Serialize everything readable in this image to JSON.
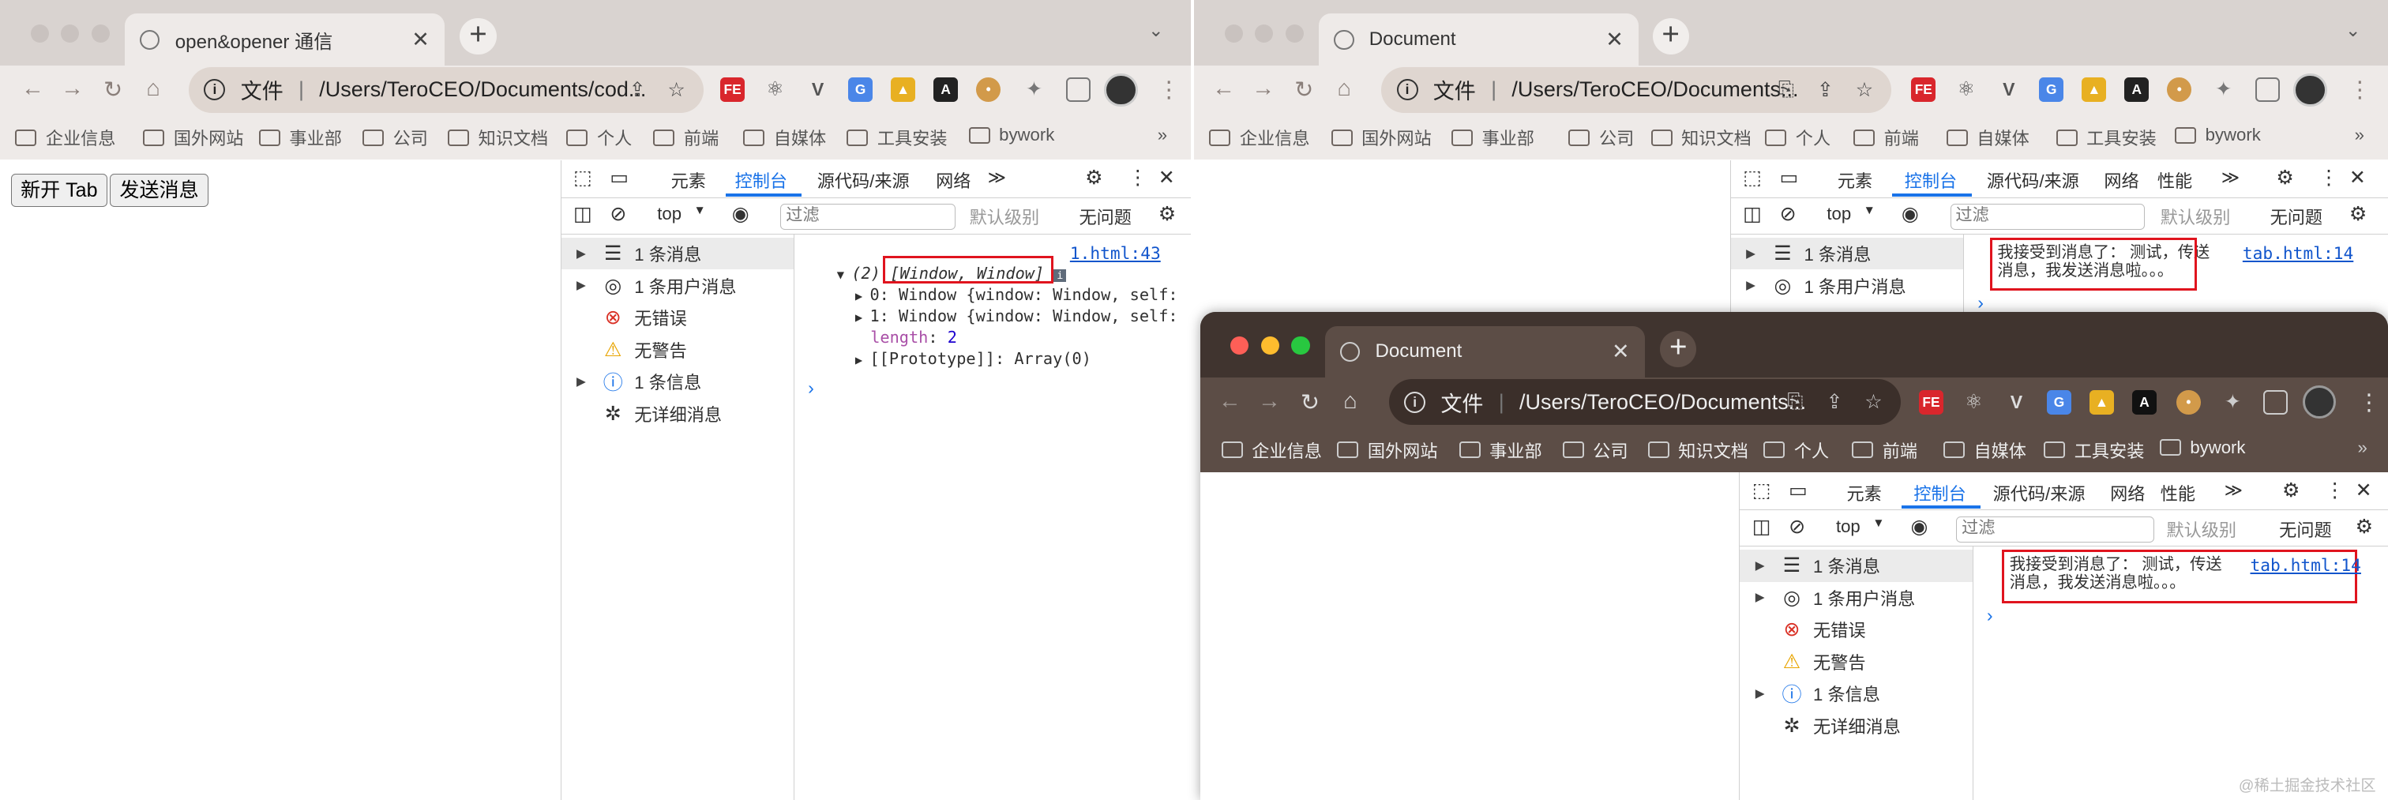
{
  "window1": {
    "tab_title": "open&opener 通信",
    "url_scheme": "文件",
    "url": "/Users/TeroCEO/Documents/cod...",
    "bookmarks": [
      "企业信息",
      "国外网站",
      "事业部",
      "公司",
      "知识文档",
      "个人",
      "前端",
      "自媒体",
      "工具安装",
      "bywork"
    ],
    "page_buttons": {
      "new_tab": "新开 Tab",
      "send": "发送消息"
    },
    "devtools": {
      "tabs": [
        "元素",
        "控制台",
        "源代码/来源",
        "网络"
      ],
      "context": "top",
      "filter_placeholder": "过滤",
      "levels": "默认级别",
      "issues": "无问题",
      "sidebar": [
        "1 条消息",
        "1 条用户消息",
        "无错误",
        "无警告",
        "1 条信息",
        "无详细消息"
      ],
      "log": {
        "source": "1.html:43",
        "summary_count": "(2)",
        "summary": "[Window, Window]",
        "lines": [
          "0: Window {window: Window, self:",
          "1: Window {window: Window, self:"
        ],
        "length_key": "length",
        "length_val": "2",
        "proto": "[[Prototype]]: Array(0)"
      }
    }
  },
  "window2": {
    "tab_title": "Document",
    "url_scheme": "文件",
    "url": "/Users/TeroCEO/Documents...",
    "bookmarks": [
      "企业信息",
      "国外网站",
      "事业部",
      "公司",
      "知识文档",
      "个人",
      "前端",
      "自媒体",
      "工具安装",
      "bywork"
    ],
    "devtools": {
      "tabs": [
        "元素",
        "控制台",
        "源代码/来源",
        "网络",
        "性能"
      ],
      "context": "top",
      "filter_placeholder": "过滤",
      "levels": "默认级别",
      "issues": "无问题",
      "sidebar": [
        "1 条消息",
        "1 条用户消息"
      ],
      "message": "我接受到消息了： 测试，传送消息，我发送消息啦。。。",
      "source": "tab.html:14"
    }
  },
  "window3": {
    "tab_title": "Document",
    "url_scheme": "文件",
    "url": "/Users/TeroCEO/Documents...",
    "bookmarks": [
      "企业信息",
      "国外网站",
      "事业部",
      "公司",
      "知识文档",
      "个人",
      "前端",
      "自媒体",
      "工具安装",
      "bywork"
    ],
    "devtools": {
      "tabs": [
        "元素",
        "控制台",
        "源代码/来源",
        "网络",
        "性能"
      ],
      "context": "top",
      "filter_placeholder": "过滤",
      "levels": "默认级别",
      "issues": "无问题",
      "sidebar": [
        "1 条消息",
        "1 条用户消息",
        "无错误",
        "无警告",
        "1 条信息",
        "无详细消息"
      ],
      "message": "我接受到消息了： 测试，传送消息，我发送消息啦。。。",
      "source": "tab.html:14"
    }
  },
  "watermark": "@稀土掘金技术社区",
  "colors": {
    "red_box": "#e0141e",
    "active_tab": "#1a73e8",
    "titlebar_light": "#d9d3d0",
    "titlebar_dark": "#40342f"
  }
}
